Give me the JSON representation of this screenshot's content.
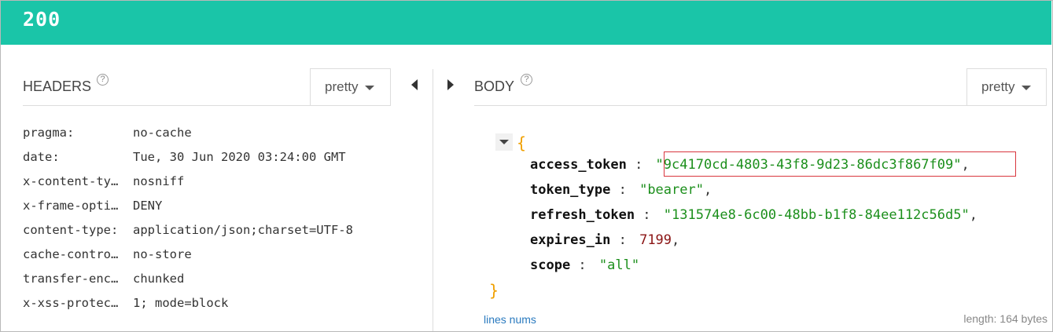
{
  "status": {
    "code": "200"
  },
  "headers_panel": {
    "title": "HEADERS",
    "help": "?",
    "format_label": "pretty",
    "rows": [
      {
        "key": "pragma:",
        "value": "no-cache"
      },
      {
        "key": "date:",
        "value": "Tue, 30 Jun 2020 03:24:00 GMT"
      },
      {
        "key": "x-content-ty…",
        "value": "nosniff"
      },
      {
        "key": "x-frame-opti…",
        "value": "DENY"
      },
      {
        "key": "content-type:",
        "value": "application/json;charset=UTF-8"
      },
      {
        "key": "cache-contro…",
        "value": "no-store"
      },
      {
        "key": "transfer-enc…",
        "value": "chunked"
      },
      {
        "key": "x-xss-protec…",
        "value": "1; mode=block"
      }
    ]
  },
  "body_panel": {
    "title": "BODY",
    "help": "?",
    "format_label": "pretty",
    "open_brace": "{",
    "close_brace": "}",
    "fields": [
      {
        "key": "access_token",
        "value": "\"9c4170cd-4803-43f8-9d23-86dc3f867f09\"",
        "type": "string"
      },
      {
        "key": "token_type",
        "value": "\"bearer\"",
        "type": "string"
      },
      {
        "key": "refresh_token",
        "value": "\"131574e8-6c00-48bb-b1f8-84ee112c56d5\"",
        "type": "string"
      },
      {
        "key": "expires_in",
        "value": "7199",
        "type": "number"
      },
      {
        "key": "scope",
        "value": "\"all\"",
        "type": "string"
      }
    ],
    "lines_nums_label": "lines nums",
    "length_label": "length: 164 bytes"
  },
  "colors": {
    "status_bar": "#1ac5a8",
    "highlight": "#d9363e"
  }
}
